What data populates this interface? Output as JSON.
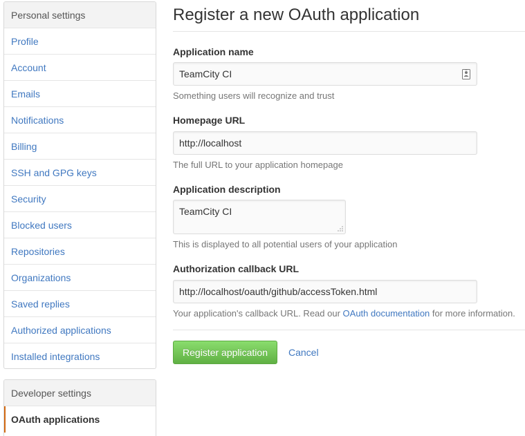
{
  "sidebar": {
    "personal_heading": "Personal settings",
    "items": [
      {
        "label": "Profile"
      },
      {
        "label": "Account"
      },
      {
        "label": "Emails"
      },
      {
        "label": "Notifications"
      },
      {
        "label": "Billing"
      },
      {
        "label": "SSH and GPG keys"
      },
      {
        "label": "Security"
      },
      {
        "label": "Blocked users"
      },
      {
        "label": "Repositories"
      },
      {
        "label": "Organizations"
      },
      {
        "label": "Saved replies"
      },
      {
        "label": "Authorized applications"
      },
      {
        "label": "Installed integrations"
      }
    ],
    "developer_heading": "Developer settings",
    "developer_items": [
      {
        "label": "OAuth applications",
        "selected": true
      }
    ]
  },
  "form": {
    "title": "Register a new OAuth application",
    "app_name": {
      "label": "Application name",
      "value": "TeamCity CI",
      "note": "Something users will recognize and trust"
    },
    "homepage": {
      "label": "Homepage URL",
      "value": "http://localhost",
      "note": "The full URL to your application homepage"
    },
    "description": {
      "label": "Application description",
      "value": "TeamCity CI",
      "note": "This is displayed to all potential users of your application"
    },
    "callback": {
      "label": "Authorization callback URL",
      "value": "http://localhost/oauth/github/accessToken.html",
      "note_prefix": "Your application's callback URL. Read our ",
      "note_link": "OAuth documentation",
      "note_suffix": " for more information."
    },
    "submit_label": "Register application",
    "cancel_label": "Cancel"
  },
  "colors": {
    "link": "#4078c0",
    "primary_button": "#60b044",
    "selected_marker": "#d26911"
  },
  "icons": {
    "field_autofill": "contact-card-icon",
    "textarea_resize": "resize-grip-icon"
  }
}
